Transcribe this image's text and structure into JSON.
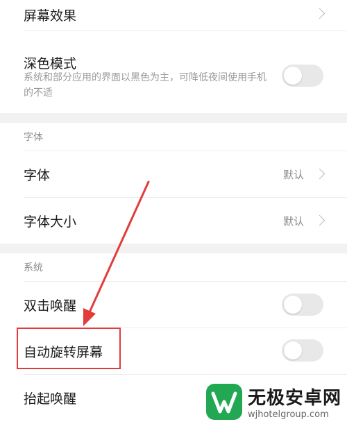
{
  "settings": {
    "screen_effect": {
      "label": "屏幕效果"
    },
    "dark_mode": {
      "label": "深色模式",
      "description": "系统和部分应用的界面以黑色为主，可降低夜间使用手机的不适",
      "enabled": false
    },
    "font_section": {
      "title": "字体",
      "items": [
        {
          "label": "字体",
          "value": "默认"
        },
        {
          "label": "字体大小",
          "value": "默认"
        }
      ]
    },
    "system_section": {
      "title": "系统",
      "items": [
        {
          "label": "双击唤醒",
          "enabled": false
        },
        {
          "label": "自动旋转屏幕",
          "enabled": false
        },
        {
          "label": "抬起唤醒"
        }
      ]
    }
  },
  "watermark": {
    "title": "无极安卓网",
    "url": "wjhotelgroup.com"
  },
  "colors": {
    "annotation": "#e23b3b",
    "toggle_off": "#e8e8e8",
    "brand_green": "#22a852"
  }
}
